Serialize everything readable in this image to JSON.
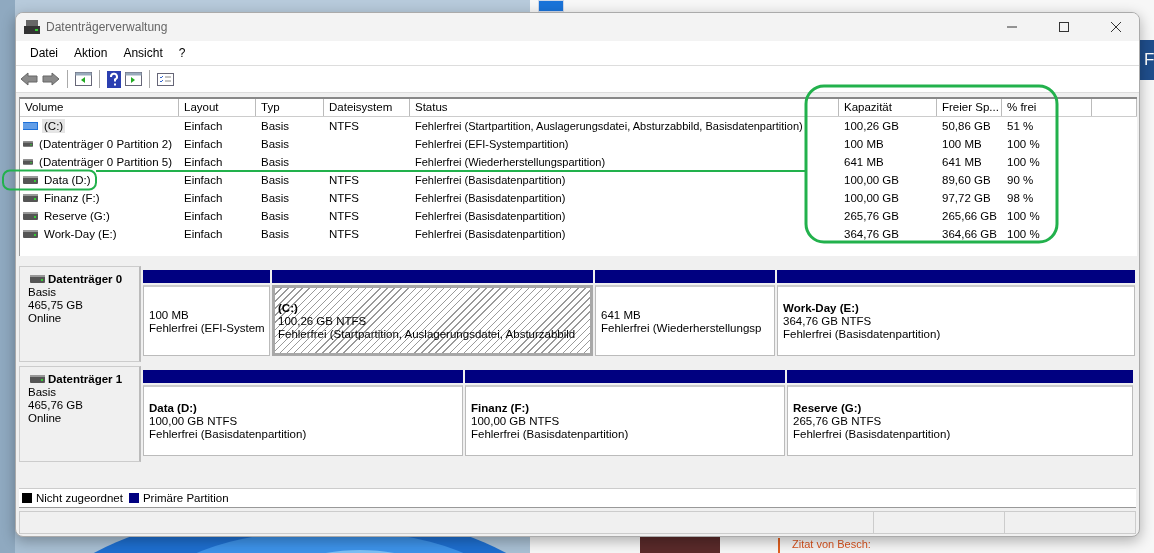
{
  "background": {
    "side_letter": "F",
    "quote_link": "Zitat von Besch:"
  },
  "window": {
    "title": "Datenträgerverwaltung"
  },
  "menu": [
    "Datei",
    "Aktion",
    "Ansicht",
    "?"
  ],
  "toolbar": [
    {
      "kind": "back"
    },
    {
      "kind": "forward"
    },
    {
      "kind": "separator"
    },
    {
      "kind": "console-tree"
    },
    {
      "kind": "separator"
    },
    {
      "kind": "help"
    },
    {
      "kind": "action-pane"
    },
    {
      "kind": "separator"
    },
    {
      "kind": "properties"
    }
  ],
  "table": {
    "columns": [
      "Volume",
      "Layout",
      "Typ",
      "Dateisystem",
      "Status",
      "Kapazität",
      "Freier Sp...",
      "% frei"
    ],
    "rows": [
      {
        "kind": "system",
        "selected": true,
        "cells": [
          "(C:)",
          "Einfach",
          "Basis",
          "NTFS",
          "Fehlerfrei (Startpartition, Auslagerungsdatei, Absturzabbild, Basisdatenpartition)",
          "100,26 GB",
          "50,86 GB",
          "51 %"
        ]
      },
      {
        "kind": "drive",
        "selected": false,
        "cells": [
          "(Datenträger 0 Partition 2)",
          "Einfach",
          "Basis",
          "",
          "Fehlerfrei (EFI-Systempartition)",
          "100 MB",
          "100 MB",
          "100 %"
        ]
      },
      {
        "kind": "drive",
        "selected": false,
        "cells": [
          "(Datenträger 0 Partition 5)",
          "Einfach",
          "Basis",
          "",
          "Fehlerfrei (Wiederherstellungspartition)",
          "641 MB",
          "641 MB",
          "100 %"
        ]
      },
      {
        "kind": "drive",
        "selected": false,
        "cells": [
          "Data (D:)",
          "Einfach",
          "Basis",
          "NTFS",
          "Fehlerfrei (Basisdatenpartition)",
          "100,00 GB",
          "89,60 GB",
          "90 %"
        ]
      },
      {
        "kind": "drive",
        "selected": false,
        "cells": [
          "Finanz (F:)",
          "Einfach",
          "Basis",
          "NTFS",
          "Fehlerfrei (Basisdatenpartition)",
          "100,00 GB",
          "97,72 GB",
          "98 %"
        ]
      },
      {
        "kind": "drive",
        "selected": false,
        "cells": [
          "Reserve (G:)",
          "Einfach",
          "Basis",
          "NTFS",
          "Fehlerfrei (Basisdatenpartition)",
          "265,76 GB",
          "265,66 GB",
          "100 %"
        ]
      },
      {
        "kind": "drive",
        "selected": false,
        "cells": [
          "Work-Day (E:)",
          "Einfach",
          "Basis",
          "NTFS",
          "Fehlerfrei (Basisdatenpartition)",
          "364,76 GB",
          "364,66 GB",
          "100 %"
        ]
      }
    ]
  },
  "disks": [
    {
      "name": "Datenträger 0",
      "type": "Basis",
      "size": "465,75 GB",
      "state": "Online",
      "partitions": [
        {
          "size": "100 MB",
          "status": "Fehlerfrei (EFI-System",
          "selected": false
        },
        {
          "label": "(C:)",
          "size": "100,26 GB NTFS",
          "status": "Fehlerfrei (Startpartition, Auslagerungsdatei, Absturzabbild",
          "selected": true
        },
        {
          "size": "641 MB",
          "status": "Fehlerfrei (Wiederherstellungsp",
          "selected": false
        },
        {
          "label": "Work-Day  (E:)",
          "size": "364,76 GB NTFS",
          "status": "Fehlerfrei (Basisdatenpartition)",
          "selected": false
        }
      ]
    },
    {
      "name": "Datenträger 1",
      "type": "Basis",
      "size": "465,76 GB",
      "state": "Online",
      "partitions": [
        {
          "label": "Data  (D:)",
          "size": "100,00 GB NTFS",
          "status": "Fehlerfrei (Basisdatenpartition)",
          "selected": false
        },
        {
          "label": "Finanz  (F:)",
          "size": "100,00 GB NTFS",
          "status": "Fehlerfrei (Basisdatenpartition)",
          "selected": false
        },
        {
          "label": "Reserve  (G:)",
          "size": "265,76 GB NTFS",
          "status": "Fehlerfrei (Basisdatenpartition)",
          "selected": false
        }
      ]
    }
  ],
  "legend": [
    {
      "label": "Nicht zugeordnet",
      "color": "#000000"
    },
    {
      "label": "Primäre Partition",
      "color": "#000080"
    }
  ]
}
